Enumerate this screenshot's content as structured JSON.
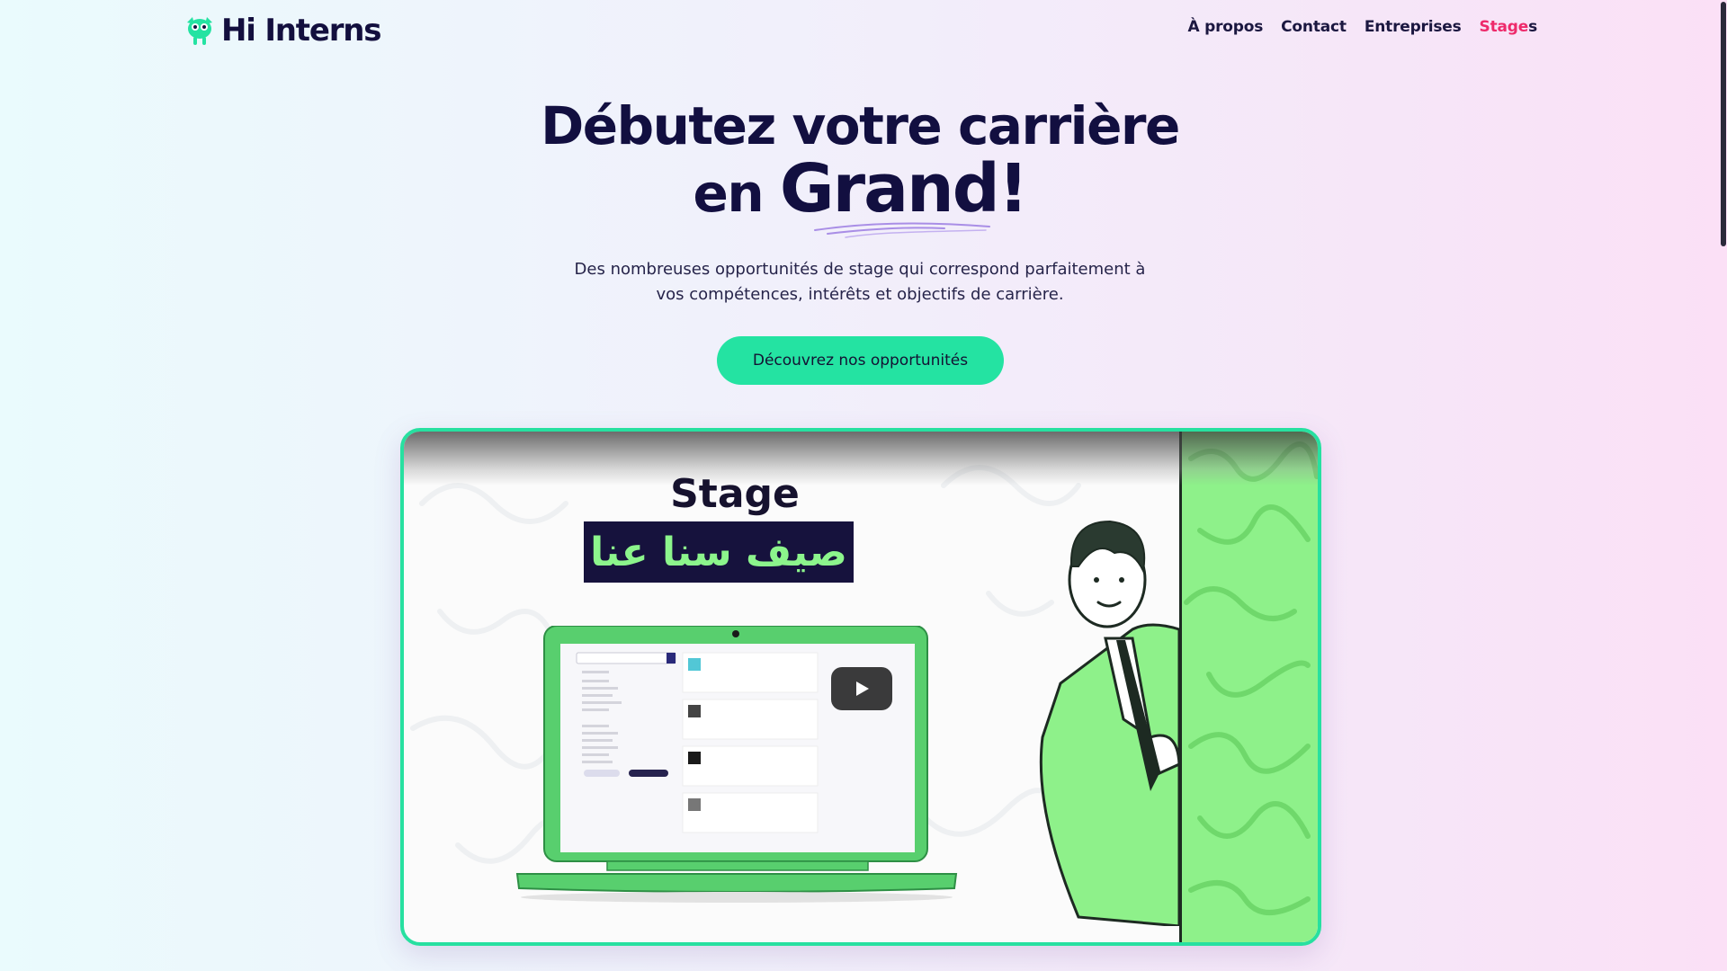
{
  "brand": {
    "name": "Hi Interns",
    "icon": "mascot-icon",
    "accent": "#24e3a2"
  },
  "nav": {
    "items": [
      {
        "label": "À propos"
      },
      {
        "label": "Contact"
      },
      {
        "label": "Entreprises"
      }
    ],
    "active": {
      "label_colored": "Stage",
      "label_tail": "s"
    }
  },
  "hero": {
    "title_line1": "Débutez votre carrière",
    "title_line2_prefix": "en ",
    "title_line2_big": "Grand!",
    "subtitle_line1": "Des nombreuses opportunités de stage qui correspond parfaitement à",
    "subtitle_line2": "vos compétences, intérêts et objectifs de carrière.",
    "cta_label": "Découvrez nos opportunités"
  },
  "video": {
    "title": "Stage",
    "arabic_title": "صيف سنا عنا",
    "play_icon": "play-icon"
  },
  "colors": {
    "title": "#120f40",
    "nav_active": "#ee2a6b",
    "card_border": "#27e0a0",
    "panel_green": "#8ef18a"
  }
}
